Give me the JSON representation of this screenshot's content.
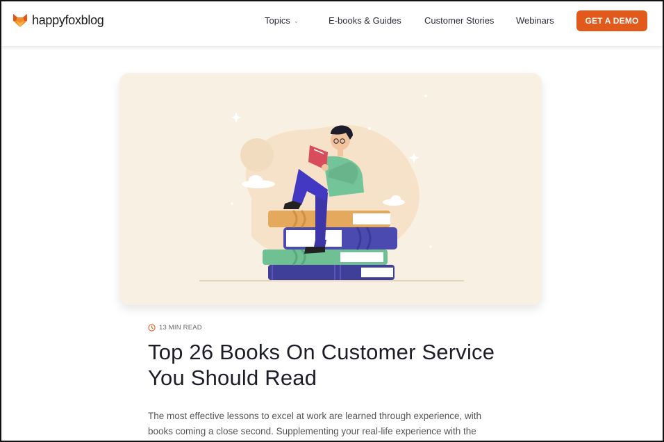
{
  "header": {
    "logo": {
      "brand": "happyfox",
      "suffix": "blog"
    },
    "nav": [
      {
        "label": "Topics",
        "has_dropdown": true
      },
      {
        "label": "E-books & Guides",
        "has_dropdown": false
      },
      {
        "label": "Customer Stories",
        "has_dropdown": false
      },
      {
        "label": "Webinars",
        "has_dropdown": false
      }
    ],
    "cta_label": "GET A DEMO",
    "cta_color": "#e2591c"
  },
  "article": {
    "read_time": "13 MIN READ",
    "title_line1": "Top 26 Books On Customer Service",
    "title_line2": "You Should Read",
    "excerpt_line1": "The most effective lessons to excel at work are learned through experience, with",
    "excerpt_line2": "books coming a close second. Supplementing your real-life experience with the"
  },
  "colors": {
    "accent": "#e2591c",
    "hero_bg": "#f9f0e4"
  }
}
